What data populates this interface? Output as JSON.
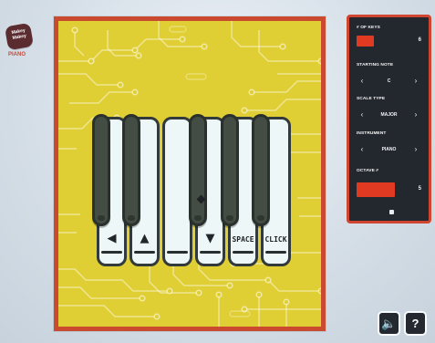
{
  "app": {
    "logo_line1": "Makey",
    "logo_line2": "Makey",
    "logo_sub": "PIANO"
  },
  "piano": {
    "white_keys": [
      {
        "label": "",
        "icon": "left-arrow-icon",
        "glyph": "◀"
      },
      {
        "label": "",
        "icon": "up-arrow-icon",
        "glyph": "▲"
      },
      {
        "label": "",
        "icon": "",
        "glyph": ""
      },
      {
        "label": "",
        "icon": "down-arrow-icon",
        "glyph": "▼"
      },
      {
        "label": "SPACE",
        "icon": "",
        "glyph": ""
      },
      {
        "label": "CLICK",
        "icon": "",
        "glyph": ""
      }
    ],
    "black_keys": [
      {
        "marker": ""
      },
      {
        "marker": ""
      },
      {
        "marker": "diamond"
      },
      {
        "marker": ""
      },
      {
        "marker": ""
      }
    ]
  },
  "settings": {
    "keys_title": "# OF KEYS",
    "keys_value": "6",
    "starting_note_title": "STARTING NOTE",
    "starting_note_value": "C",
    "scale_type_title": "SCALE TYPE",
    "scale_type_value": "MAJOR",
    "instrument_title": "INSTRUMENT",
    "instrument_value": "PIANO",
    "octave_title": "OCTAVE #",
    "octave_value": "5",
    "prev_glyph": "‹",
    "next_glyph": "›"
  },
  "controls": {
    "sound_icon": "speaker-icon",
    "help_icon": "help-icon",
    "sound_glyph": "🔈",
    "help_glyph": "?"
  },
  "colors": {
    "board_yellow": "#e0cf34",
    "board_border": "#c94a2f",
    "panel_bg": "#23272e",
    "accent_red": "#e03b22"
  }
}
